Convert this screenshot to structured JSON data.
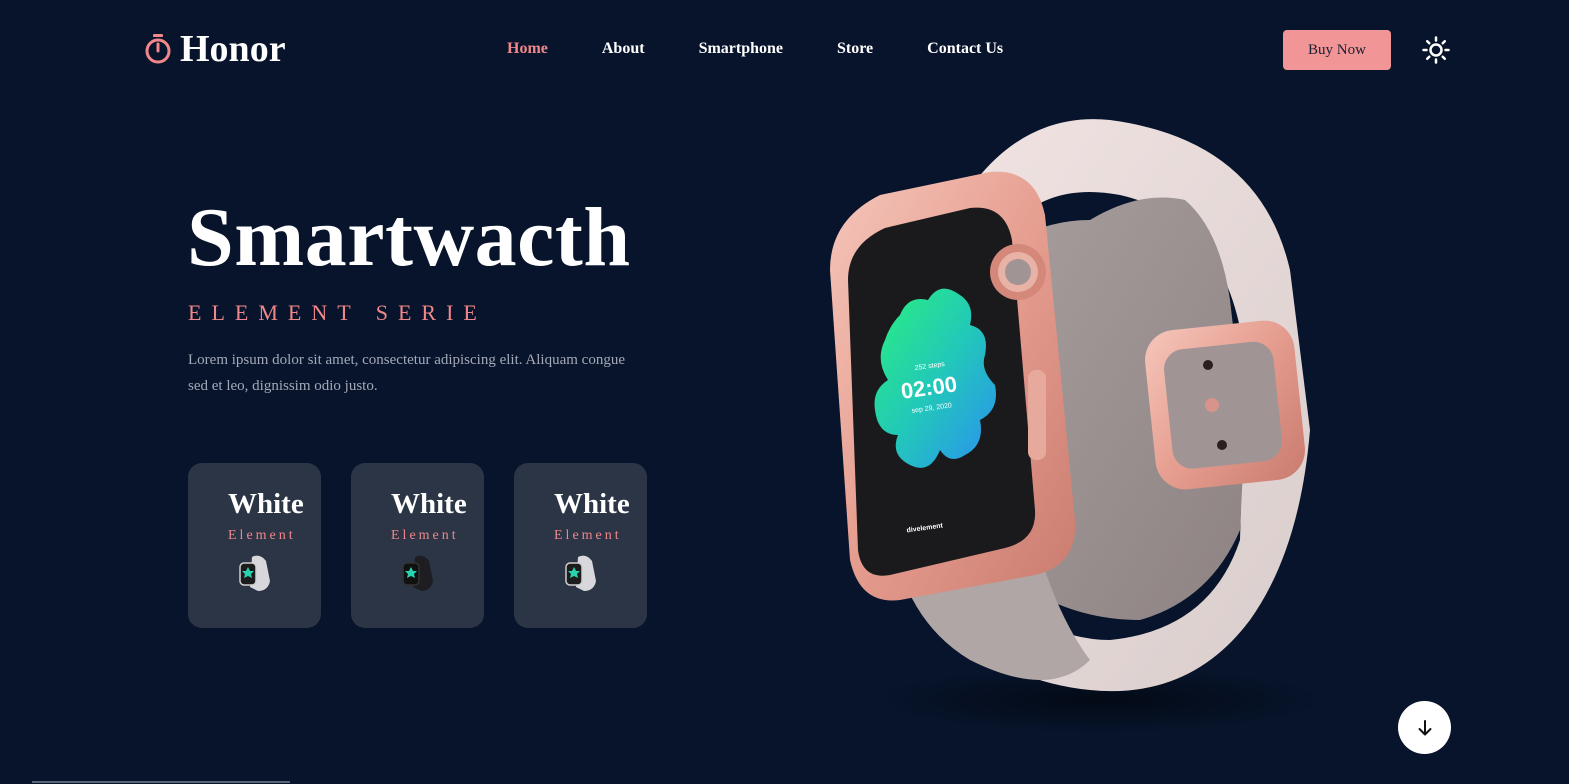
{
  "header": {
    "logo_text": "Honor",
    "logo_icon": "stopwatch-icon",
    "nav": [
      {
        "label": "Home",
        "active": true
      },
      {
        "label": "About",
        "active": false
      },
      {
        "label": "Smartphone",
        "active": false
      },
      {
        "label": "Store",
        "active": false
      },
      {
        "label": "Contact Us",
        "active": false
      }
    ],
    "buy_button": "Buy Now",
    "theme_icon": "sun-icon"
  },
  "hero": {
    "title": "Smartwacth",
    "subtitle": "ELEMENT SERIE",
    "description": "Lorem ipsum dolor sit amet, consectetur adipiscing elit. Aliquam congue sed et leo, dignissim odio justo."
  },
  "cards": [
    {
      "title": "White",
      "subtitle": "Element",
      "watch_color": "white"
    },
    {
      "title": "White",
      "subtitle": "Element",
      "watch_color": "black"
    },
    {
      "title": "White",
      "subtitle": "Element",
      "watch_color": "white"
    }
  ],
  "watch_screen": {
    "steps": "252 steps",
    "time": "02:00",
    "date": "sep 29, 2020",
    "brand": "divelement"
  },
  "scroll_icon": "arrow-down-icon",
  "colors": {
    "background": "#07142b",
    "accent": "#f0878a",
    "button": "#f29596",
    "card": "#2b3546"
  }
}
